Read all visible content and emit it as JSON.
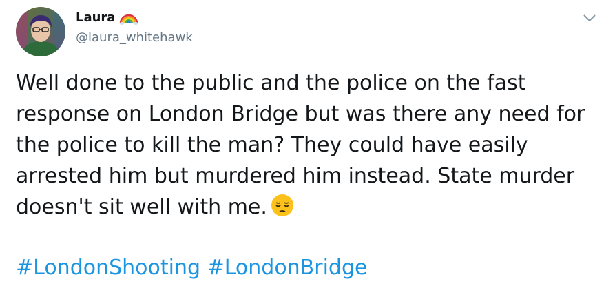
{
  "user": {
    "display_name": "Laura",
    "handle": "@laura_whitehawk",
    "badge_icon": "rainbow-icon",
    "avatar_icon": "avatar-photo"
  },
  "tweet": {
    "text": "Well done to the public and the police on the fast response on London Bridge but was there any need for the police to kill the man? They could have easily arrested him but murdered him instead. State murder doesn't sit well with me.",
    "emoji": "pensive-face-emoji",
    "hashtags": [
      "#LondonShooting",
      "#LondonBridge"
    ]
  },
  "menu": {
    "caret_icon": "chevron-down-icon"
  },
  "colors": {
    "text": "#14171a",
    "secondary": "#657786",
    "link": "#1b95e0",
    "background": "#ffffff"
  }
}
